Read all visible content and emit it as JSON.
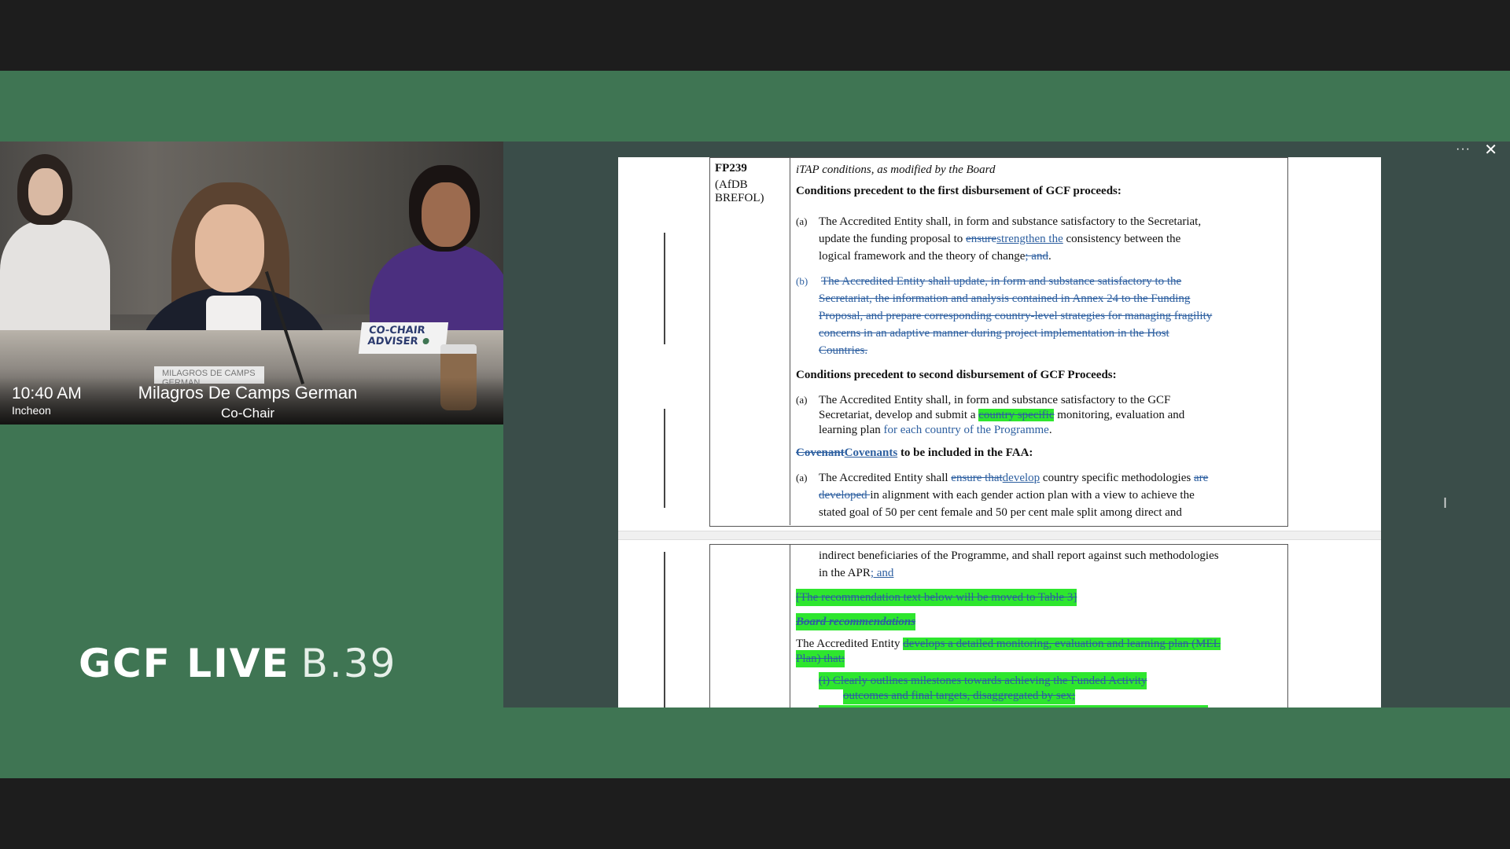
{
  "camera": {
    "time": "10:40 AM",
    "city": "Incheon",
    "speaker_name": "Milagros De Camps German",
    "speaker_role": "Co-Chair",
    "nameplate": "CO-CHAIR ADVISER",
    "nameplate_small": "MILAGROS DE CAMPS GERMAN"
  },
  "logo": {
    "main": "GCF LIVE",
    "session": "B.39"
  },
  "share_controls": {
    "more_icon": "···",
    "close_icon": "✕"
  },
  "document": {
    "id_code": "FP239",
    "id_sub1": "(AfDB",
    "id_sub2": "BREFOL)",
    "heading_itap": "iTAP conditions, as modified by the Board",
    "h_first": "Conditions precedent to the first disbursement of GCF proceeds:",
    "a1_marker": "(a)",
    "a1_l1": "The Accredited Entity shall, in form and substance satisfactory to the Secretariat,",
    "a1_l2_pre": "update the funding proposal to ",
    "a1_l2_del": "ensure",
    "a1_l2_ins": "strengthen the",
    "a1_l2_post": " consistency between the",
    "a1_l3_pre": "logical framework and the theory of change",
    "a1_l3_del": "; and",
    "a1_l3_post": ".",
    "b1_marker": "(b)",
    "b1_l1": "The Accredited Entity shall update, in form and substance satisfactory to the",
    "b1_l2": "Secretariat, the information and analysis contained in Annex 24 to the Funding",
    "b1_l3": "Proposal, and prepare corresponding country-level strategies for managing fragility",
    "b1_l4": "concerns in an adaptive manner during project implementation in the Host",
    "b1_l5": "Countries.",
    "h_second": "Conditions precedent to second disbursement of GCF Proceeds:",
    "a2_marker": "(a)",
    "a2_l1": "The Accredited Entity shall, in form and substance satisfactory to the GCF",
    "a2_l2_pre": "Secretariat, develop and submit a ",
    "a2_l2_hl": "country specific",
    "a2_l2_post": " monitoring, evaluation and",
    "a2_l3_pre": "learning plan ",
    "a2_l3_ins": "for each country of the Programme",
    "a2_l3_post": ".",
    "cov_del": "Covenant",
    "cov_ins": "Covenants",
    "cov_post": " to be included in the FAA:",
    "a3_marker": "(a)",
    "a3_l1_pre": "The Accredited Entity shall ",
    "a3_l1_del": "ensure that",
    "a3_l1_ins": "develop",
    "a3_l1_mid": " country specific methodologies ",
    "a3_l1_del2": "are",
    "a3_l2_del": "developed ",
    "a3_l2_post": "in alignment with each gender action plan with a view to achieve the",
    "a3_l3": "stated goal of 50 per cent female and 50 per cent male split among direct and",
    "p2_l1": "indirect beneficiaries of the Programme, and shall report against such methodologies",
    "p2_l2_pre": "in the APR",
    "p2_l2_ins": "; and",
    "p2_note": "[The recommendation text below will be moved to Table 3]",
    "p2_board": "Board recommendations",
    "p2_ae_pre": "The Accredited Entity ",
    "p2_ae_hl": "develops a detailed monitoring, evaluation and learning plan (MEL",
    "p2_ae_l2": "Plan) that:",
    "p2_i_l1": "(i)   Clearly outlines milestones towards achieving the Funded Activity",
    "p2_i_l2": "outcomes and final targets, disaggregated by sex;"
  },
  "colors": {
    "stage_green": "#3f7553",
    "highlight": "#2ee62e",
    "track_blue": "#2d5fa0"
  }
}
